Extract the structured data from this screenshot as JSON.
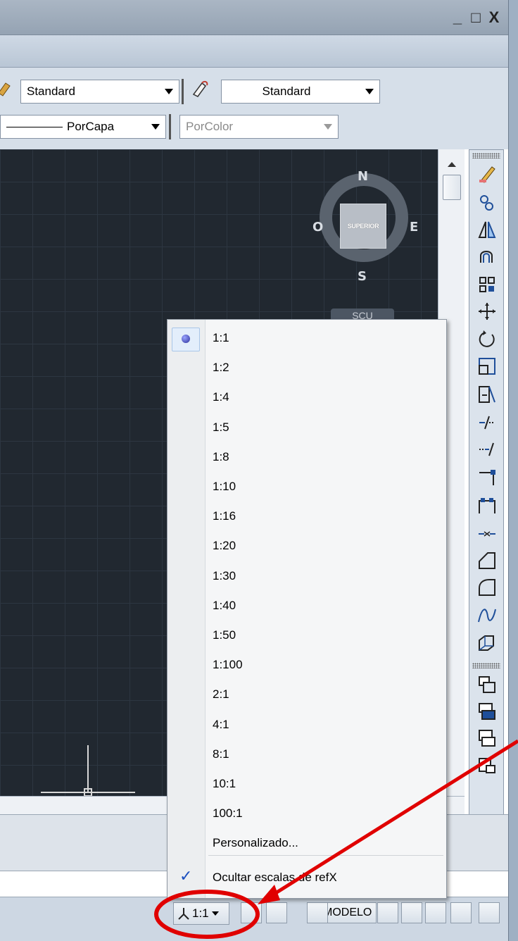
{
  "window": {
    "controls": [
      "_",
      "□",
      "X"
    ]
  },
  "toolbar": {
    "text_style": "Standard",
    "table_style": "Standard",
    "linetype": "PorCapa",
    "plot_style": "PorColor"
  },
  "viewcube": {
    "north": "N",
    "south": "S",
    "east": "E",
    "west": "O",
    "face": "SUPERIOR",
    "ucs_menu": "SCU"
  },
  "scale_menu": {
    "selected": "1:1",
    "items": [
      "1:1",
      "1:2",
      "1:4",
      "1:5",
      "1:8",
      "1:10",
      "1:16",
      "1:20",
      "1:30",
      "1:40",
      "1:50",
      "1:100",
      "2:1",
      "4:1",
      "8:1",
      "10:1",
      "100:1",
      "Personalizado..."
    ],
    "hide_xref": "Ocultar escalas de refX",
    "hide_xref_checked": true
  },
  "statusbar": {
    "modelo": "MODELO",
    "annotation_scale": "1:1"
  },
  "annotation": {
    "color": "#e00000"
  }
}
